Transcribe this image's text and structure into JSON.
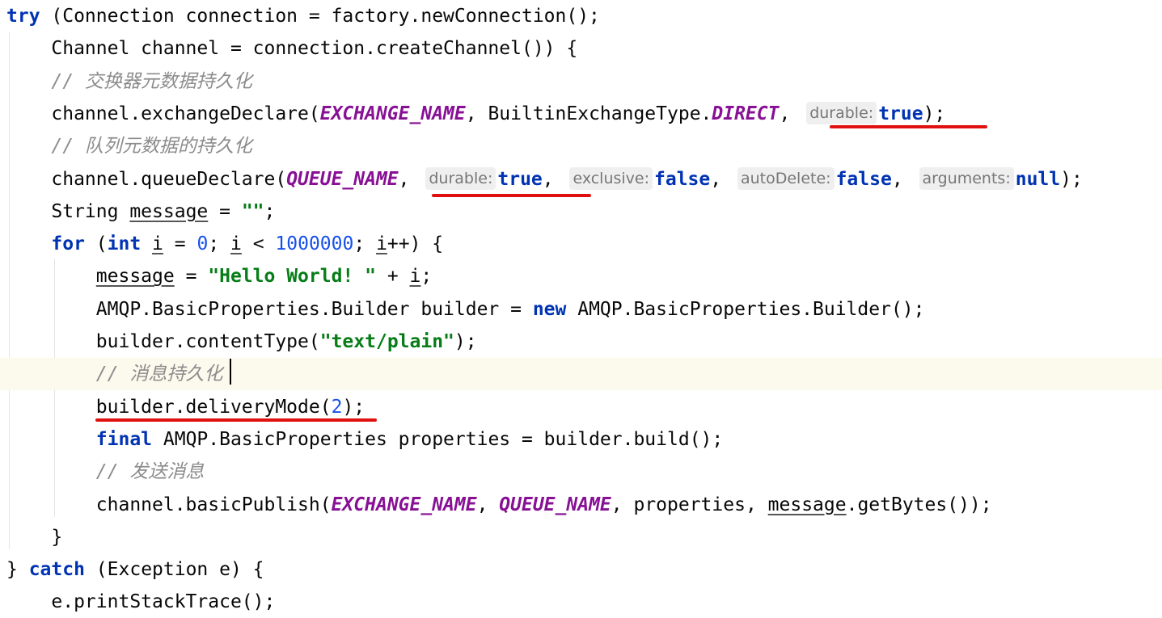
{
  "lines": [
    {
      "p": [
        {
          "t": "try",
          "c": "kw"
        },
        {
          "t": " (Connection connection = factory.newConnection();"
        }
      ]
    },
    {
      "p": [
        {
          "t": "    Channel channel = connection.createChannel()) {"
        }
      ]
    },
    {
      "p": [
        {
          "t": "    // 交换器元数据持久化",
          "c": "cmt"
        }
      ]
    },
    {
      "p": [
        {
          "t": "    channel.exchangeDeclare("
        },
        {
          "t": "EXCHANGE_NAME",
          "c": "const"
        },
        {
          "t": ", BuiltinExchangeType."
        },
        {
          "t": "DIRECT",
          "c": "const"
        },
        {
          "t": ", "
        },
        {
          "t": "durable:",
          "c": "hint"
        },
        {
          "t": "true",
          "c": "kw"
        },
        {
          "t": ");"
        }
      ]
    },
    {
      "p": [
        {
          "t": "    // 队列元数据的持久化",
          "c": "cmt"
        }
      ]
    },
    {
      "p": [
        {
          "t": "    channel.queueDeclare("
        },
        {
          "t": "QUEUE_NAME",
          "c": "const"
        },
        {
          "t": ", "
        },
        {
          "t": "durable:",
          "c": "hint"
        },
        {
          "t": "true",
          "c": "kw"
        },
        {
          "t": ", "
        },
        {
          "t": "exclusive:",
          "c": "hint"
        },
        {
          "t": "false",
          "c": "kw"
        },
        {
          "t": ", "
        },
        {
          "t": "autoDelete:",
          "c": "hint"
        },
        {
          "t": "false",
          "c": "kw"
        },
        {
          "t": ", "
        },
        {
          "t": "arguments:",
          "c": "hint"
        },
        {
          "t": "null",
          "c": "kw"
        },
        {
          "t": ");"
        }
      ]
    },
    {
      "p": [
        {
          "t": "    String "
        },
        {
          "t": "message",
          "c": "ul"
        },
        {
          "t": " = "
        },
        {
          "t": "\"\"",
          "c": "str"
        },
        {
          "t": ";"
        }
      ]
    },
    {
      "p": [
        {
          "t": "    "
        },
        {
          "t": "for",
          "c": "kw"
        },
        {
          "t": " ("
        },
        {
          "t": "int",
          "c": "kw"
        },
        {
          "t": " "
        },
        {
          "t": "i",
          "c": "ul"
        },
        {
          "t": " = "
        },
        {
          "t": "0",
          "c": "num"
        },
        {
          "t": "; "
        },
        {
          "t": "i",
          "c": "ul"
        },
        {
          "t": " < "
        },
        {
          "t": "1000000",
          "c": "num"
        },
        {
          "t": "; "
        },
        {
          "t": "i",
          "c": "ul"
        },
        {
          "t": "++) {"
        }
      ]
    },
    {
      "p": [
        {
          "t": "        "
        },
        {
          "t": "message",
          "c": "ul"
        },
        {
          "t": " = "
        },
        {
          "t": "\"Hello World! \"",
          "c": "str"
        },
        {
          "t": " + "
        },
        {
          "t": "i",
          "c": "ul"
        },
        {
          "t": ";"
        }
      ]
    },
    {
      "p": [
        {
          "t": "        AMQP.BasicProperties.Builder builder = "
        },
        {
          "t": "new",
          "c": "kw"
        },
        {
          "t": " AMQP.BasicProperties.Builder();"
        }
      ]
    },
    {
      "p": [
        {
          "t": "        builder.contentType("
        },
        {
          "t": "\"text/plain\"",
          "c": "str"
        },
        {
          "t": ");"
        }
      ]
    },
    {
      "p": [
        {
          "t": "        // 消息持久化",
          "c": "cmt"
        }
      ]
    },
    {
      "p": [
        {
          "t": "        builder.deliveryMode("
        },
        {
          "t": "2",
          "c": "num"
        },
        {
          "t": ");"
        }
      ]
    },
    {
      "p": [
        {
          "t": "        "
        },
        {
          "t": "final",
          "c": "kw"
        },
        {
          "t": " AMQP.BasicProperties properties = builder.build();"
        }
      ]
    },
    {
      "p": [
        {
          "t": "        // 发送消息",
          "c": "cmt"
        }
      ]
    },
    {
      "p": [
        {
          "t": "        channel.basicPublish("
        },
        {
          "t": "EXCHANGE_NAME",
          "c": "const"
        },
        {
          "t": ", "
        },
        {
          "t": "QUEUE_NAME",
          "c": "const"
        },
        {
          "t": ", properties, "
        },
        {
          "t": "message",
          "c": "ul"
        },
        {
          "t": ".getBytes());"
        }
      ]
    },
    {
      "p": [
        {
          "t": "    }"
        }
      ]
    },
    {
      "p": [
        {
          "t": "} "
        },
        {
          "t": "catch",
          "c": "kw"
        },
        {
          "t": " (Exception e) {"
        }
      ]
    },
    {
      "p": [
        {
          "t": "    e.printStackTrace();"
        }
      ]
    }
  ],
  "current_line_index": 11,
  "colors": {
    "keyword": "#0033b3",
    "constant": "#871094",
    "string": "#067d17",
    "number": "#1750eb",
    "comment": "#8c8c8c",
    "annotation_underline": "#e01010"
  }
}
